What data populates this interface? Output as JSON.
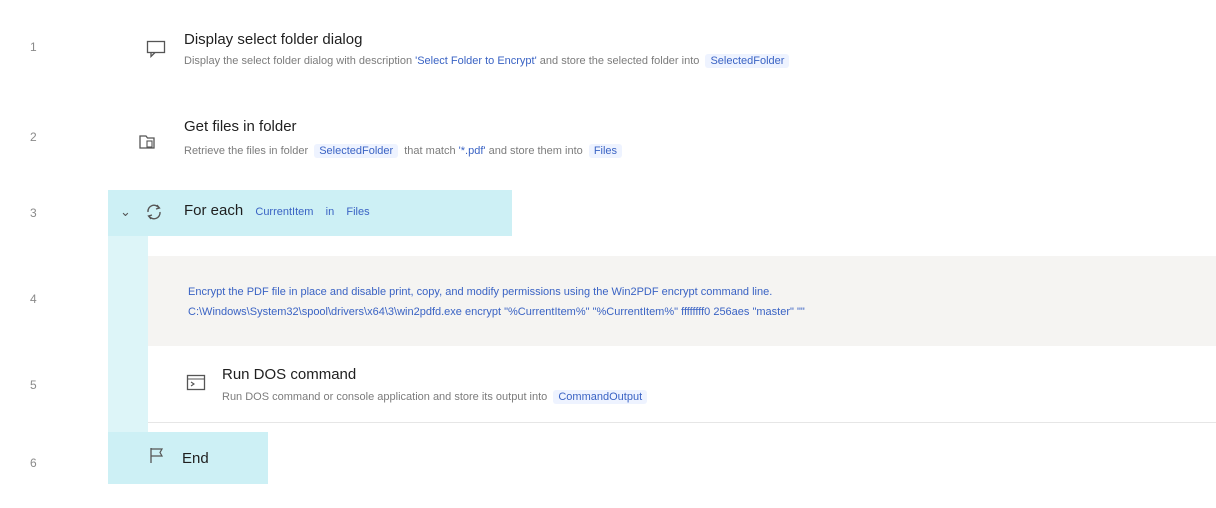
{
  "lines": [
    "1",
    "2",
    "3",
    "4",
    "5",
    "6"
  ],
  "step1": {
    "title": "Display select folder dialog",
    "desc_prefix": "Display the select folder dialog with description",
    "desc_quote": "'Select Folder to Encrypt'",
    "desc_mid": "and store the selected folder into",
    "var": "SelectedFolder"
  },
  "step2": {
    "title": "Get files in folder",
    "desc_prefix": "Retrieve the files in folder",
    "var1": "SelectedFolder",
    "desc_mid": "that match",
    "desc_quote": "'*.pdf'",
    "desc_mid2": "and store them into",
    "var2": "Files"
  },
  "loop": {
    "keyword": "For each",
    "item_var": "CurrentItem",
    "in_word": "in",
    "list_var": "Files",
    "end_label": "End"
  },
  "comment": {
    "line1": "Encrypt the PDF file in place and disable print, copy, and modify permissions using the Win2PDF encrypt command line.",
    "line2": "C:\\Windows\\System32\\spool\\drivers\\x64\\3\\win2pdfd.exe encrypt \"%CurrentItem%\" \"%CurrentItem%\" ffffffff0 256aes \"master\" \"\""
  },
  "step5": {
    "title": "Run DOS command",
    "desc_prefix": "Run DOS command or console application and store its output into",
    "var": "CommandOutput"
  },
  "icons": {
    "dialog": "dialog-icon",
    "folder_files": "folder-files-icon",
    "loop": "loop-icon",
    "chevron": "chevron-down-icon",
    "console": "console-icon",
    "flag": "flag-icon"
  }
}
